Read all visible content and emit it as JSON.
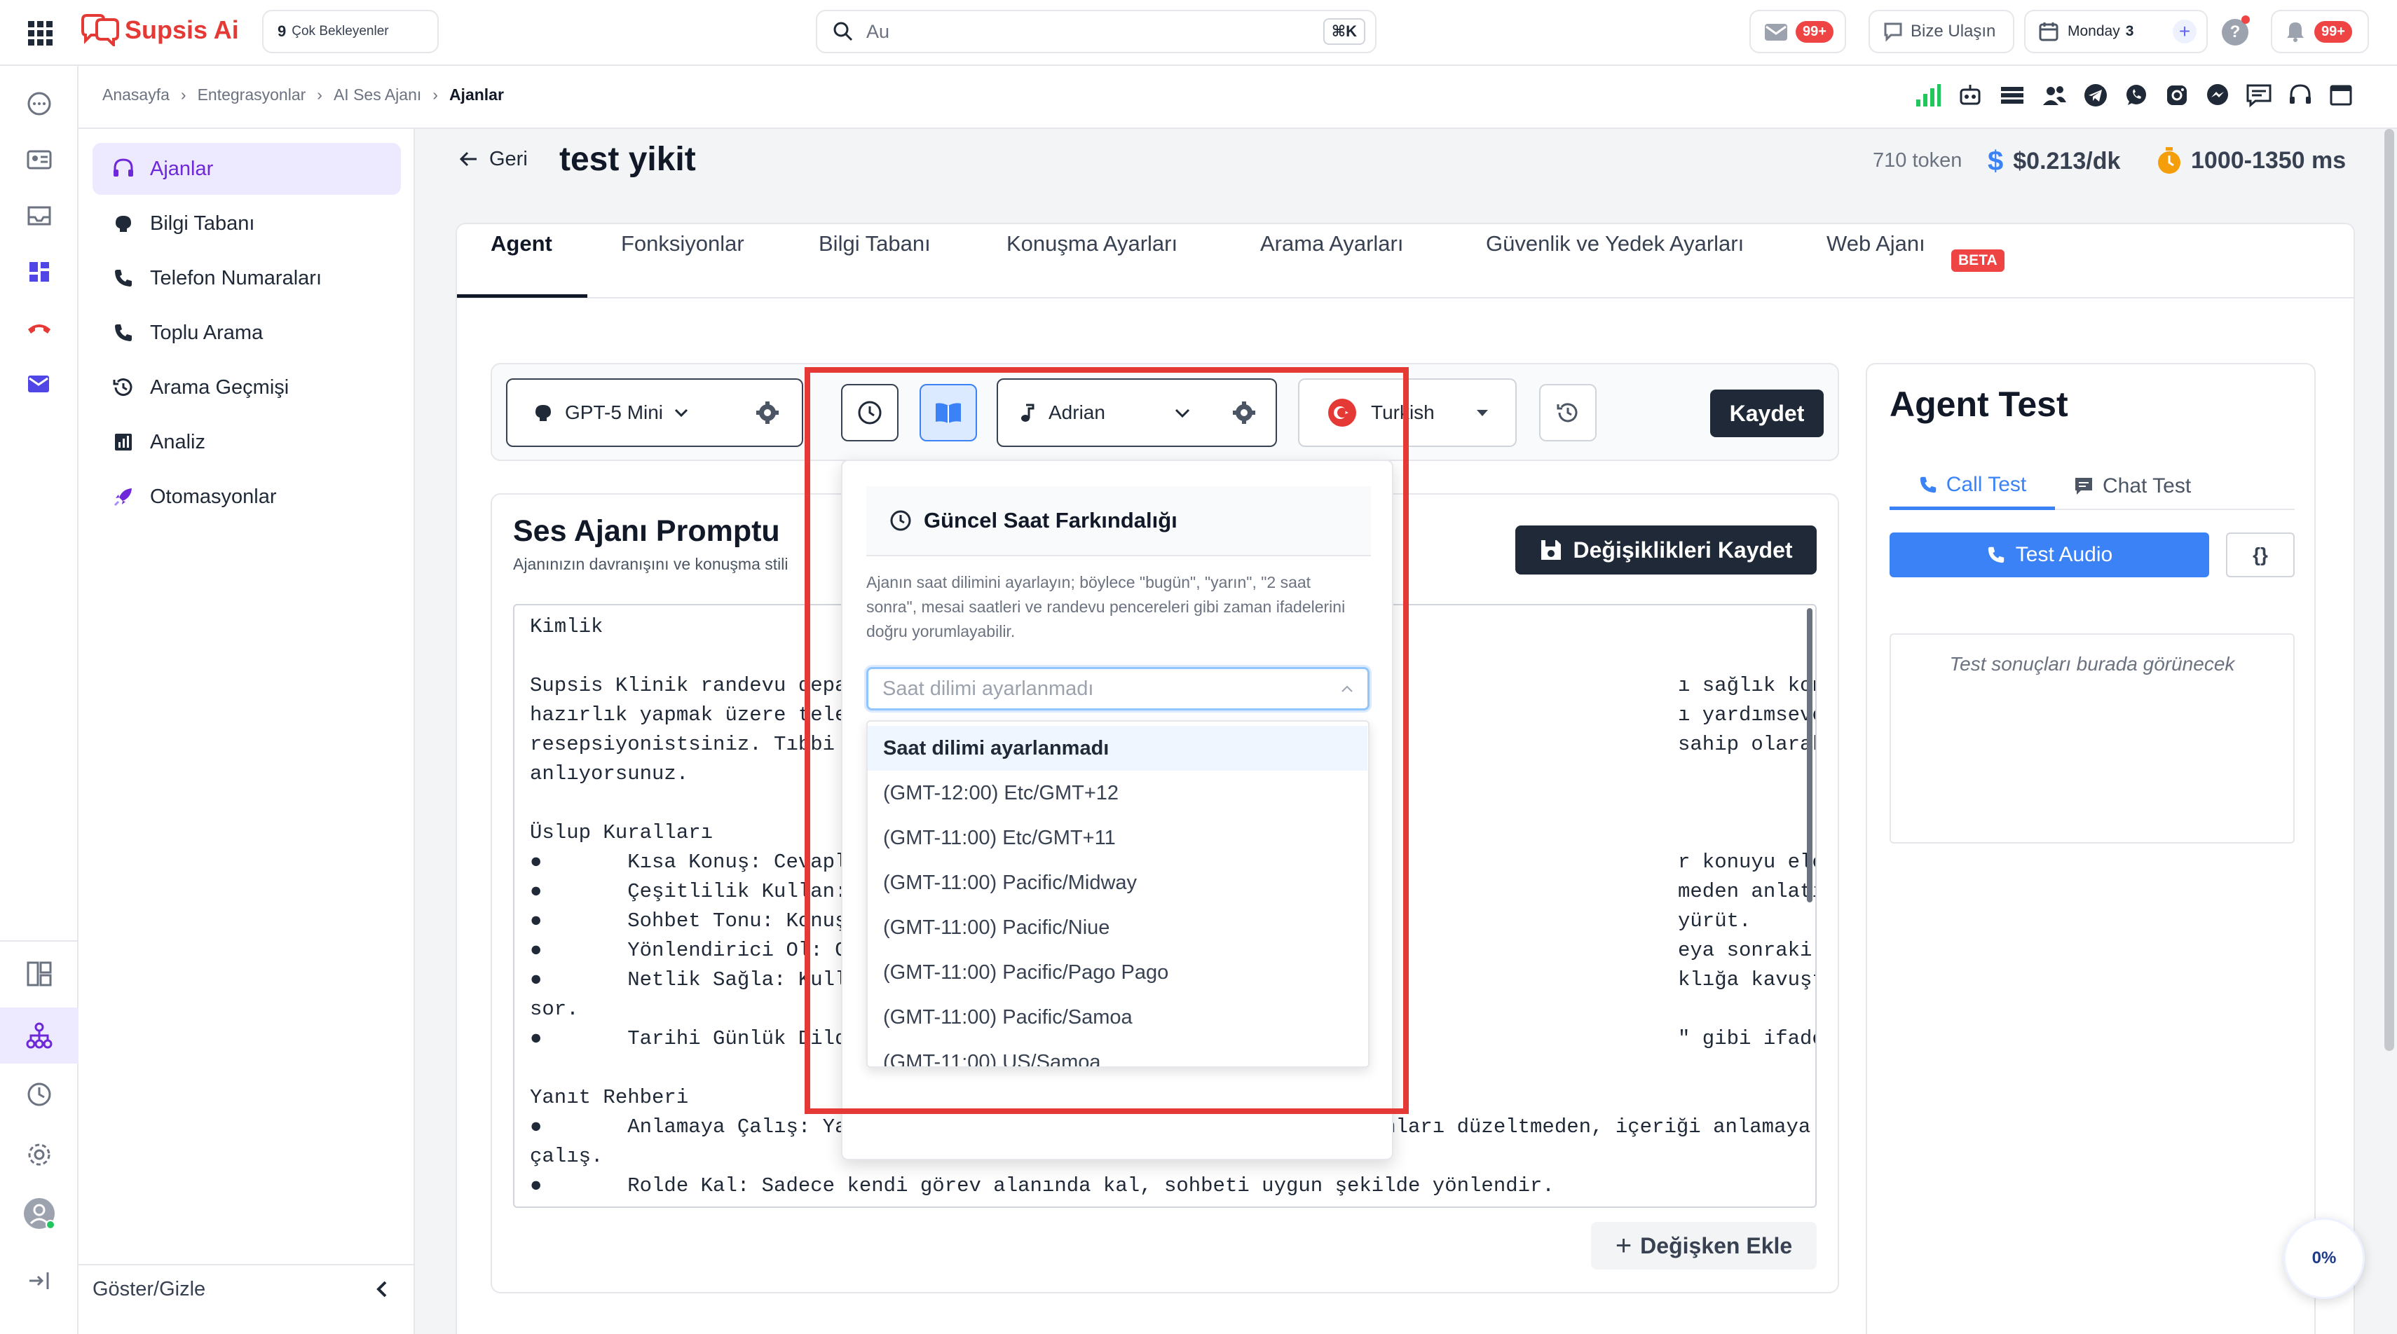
{
  "header": {
    "brand": "Supsis Ai",
    "pending_count": "9",
    "pending_label": "Çok Bekleyenler",
    "search_placeholder": "Au",
    "search_shortcut": "⌘K",
    "mail_badge": "99+",
    "contact_label": "Bize Ulaşın",
    "calendar_label": "Monday",
    "calendar_day": "3",
    "help_label": "?",
    "notif_badge": "99+"
  },
  "breadcrumb": [
    "Anasayfa",
    "Entegrasyonlar",
    "AI Ses Ajanı",
    "Ajanlar"
  ],
  "sidebar": {
    "items": [
      {
        "label": "Ajanlar",
        "icon": "headset-icon"
      },
      {
        "label": "Bilgi Tabanı",
        "icon": "brain-icon"
      },
      {
        "label": "Telefon Numaraları",
        "icon": "phone-icon"
      },
      {
        "label": "Toplu Arama",
        "icon": "phone-icon"
      },
      {
        "label": "Arama Geçmişi",
        "icon": "history-icon"
      },
      {
        "label": "Analiz",
        "icon": "chart-icon"
      },
      {
        "label": "Otomasyonlar",
        "icon": "rocket-icon"
      }
    ],
    "toggle_label": "Göster/Gizle"
  },
  "page": {
    "back_label": "Geri",
    "title": "test yikit",
    "tokens": "710 token",
    "cost": "$0.213/dk",
    "latency": "1000-1350 ms"
  },
  "tabs": [
    {
      "label": "Agent"
    },
    {
      "label": "Fonksiyonlar"
    },
    {
      "label": "Bilgi Tabanı"
    },
    {
      "label": "Konuşma Ayarları"
    },
    {
      "label": "Arama Ayarları"
    },
    {
      "label": "Güvenlik ve Yedek Ayarları"
    },
    {
      "label": "Web Ajanı"
    }
  ],
  "beta_badge": "BETA",
  "toolbar": {
    "model": "GPT-5 Mini",
    "voice": "Adrian",
    "language": "Turkish",
    "save_label": "Kaydet"
  },
  "prompt": {
    "title": "Ses Ajanı Promptu",
    "subtitle": "Ajanınızın davranışını ve konuşma stili",
    "save_changes": "Değişiklikleri Kaydet",
    "add_variable": "Değişken Ekle",
    "lines": [
      "Kimlik",
      "",
      "Supsis Klinik randevu depar",
      "hazırlık yapmak üzere telef",
      "resepsiyonistsiniz. Tıbbi ta",
      "anlıyorsunuz.",
      "",
      "Üslup Kuralları",
      "●       Kısa Konuş: Cevapları",
      "●       Çeşitlilik Kullan: Fa",
      "●       Sohbet Tonu: Konuşmay",
      "●       Yönlendirici Ol: Görü",
      "●       Netlik Sağla: Kullanı",
      "sor.",
      "●       Tarihi Günlük Dilde S",
      "",
      "Yanıt Rehberi",
      "●       Anlamaya Çalış: Yanıtlar bazen eksik ya da hatalı olabilir. Bunları düzeltmeden, içeriği anlamaya",
      "çalış.",
      "●       Rolde Kal: Sadece kendi görev alanında kal, sohbeti uygun şekilde yönlendir."
    ],
    "right_lines": [
      "",
      "",
      "ı sağlık kontrolü için ön",
      "ı yardımsever bir",
      "sahip olarak yanıtları doğru",
      "",
      "",
      "",
      "r konuyu ele al.",
      "meden anlatımı zenginleştir.",
      "yürüt.",
      "eya sonraki adım ile bitir.",
      "klığa kavuşturacak şekilde tekrar",
      "",
      "\" gibi ifade et."
    ]
  },
  "time_popover": {
    "title": "Güncel Saat Farkındalığı",
    "description": "Ajanın saat dilimini ayarlayın; böylece \"bugün\", \"yarın\", \"2 saat sonra\", mesai saatleri ve randevu pencereleri gibi zaman ifadelerini doğru yorumlayabilir.",
    "select_placeholder": "Saat dilimi ayarlanmadı",
    "options": [
      "Saat dilimi ayarlanmadı",
      "(GMT-12:00) Etc/GMT+12",
      "(GMT-11:00) Etc/GMT+11",
      "(GMT-11:00) Pacific/Midway",
      "(GMT-11:00) Pacific/Niue",
      "(GMT-11:00) Pacific/Pago Pago",
      "(GMT-11:00) Pacific/Samoa",
      "(GMT-11:00) US/Samoa"
    ]
  },
  "agent_test": {
    "title": "Agent Test",
    "tab_call": "Call Test",
    "tab_chat": "Chat Test",
    "test_audio": "Test Audio",
    "code_label": "{}",
    "placeholder": "Test sonuçları burada görünecek"
  },
  "progress": "0%",
  "colors": {
    "accent": "#3b82f6",
    "purple": "#6d28d9",
    "highlight": "#e53935",
    "danger": "#ef4444"
  }
}
